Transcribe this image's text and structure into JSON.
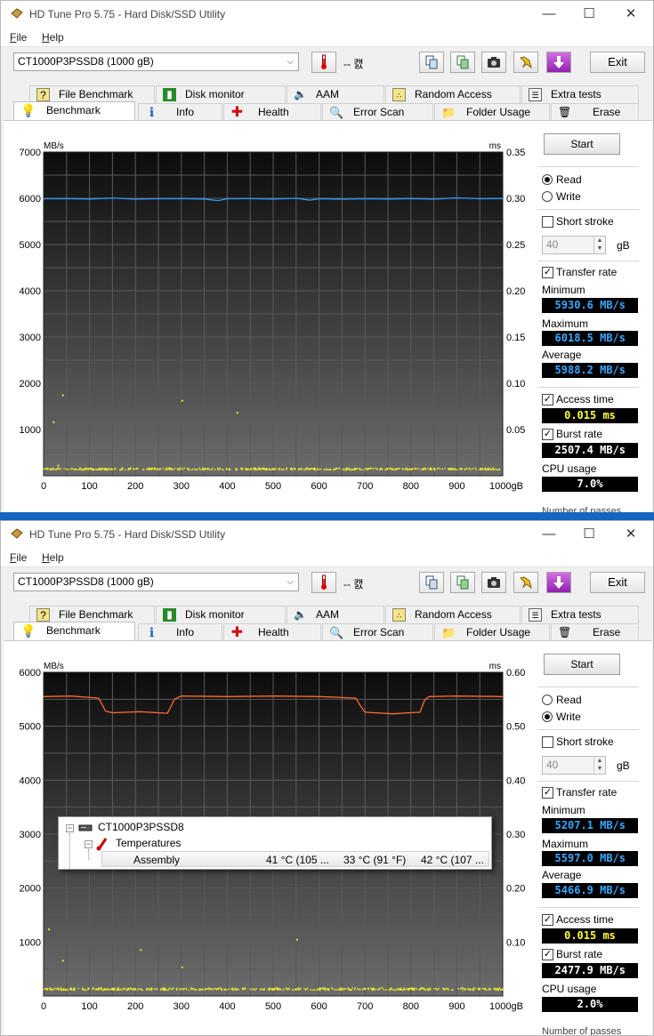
{
  "app": {
    "title": "HD Tune Pro 5.75 - Hard Disk/SSD Utility",
    "menu": {
      "file": "File",
      "file_key": "F",
      "file_rest": "ile",
      "help": "Help",
      "help_key": "H",
      "help_rest": "elp"
    },
    "window_controls": {
      "minimize": "—",
      "maximize": "☐",
      "close": "✕"
    }
  },
  "toolbar": {
    "drive": "CT1000P3PSSD8 (1000 gB)",
    "temperature": "-- 캜",
    "exit_label": "Exit",
    "icons": [
      "thermometer-icon",
      "copy-info-icon",
      "copy-screen-icon",
      "camera-icon",
      "options-icon",
      "download-icon"
    ]
  },
  "tabs": {
    "row1": [
      "File Benchmark",
      "Disk monitor",
      "AAM",
      "Random Access",
      "Extra tests"
    ],
    "row2": [
      "Benchmark",
      "Info",
      "Health",
      "Error Scan",
      "Folder Usage",
      "Erase"
    ],
    "active": "Benchmark"
  },
  "panels": [
    {
      "start_label": "Start",
      "read_label": "Read",
      "write_label": "Write",
      "mode": "read",
      "short_stroke_label": "Short stroke",
      "short_stroke_checked": false,
      "stroke_value": "40",
      "stroke_unit": "gB",
      "transfer_rate_label": "Transfer rate",
      "transfer_rate_checked": true,
      "minimum_label": "Minimum",
      "minimum": "5930.6 MB/s",
      "maximum_label": "Maximum",
      "maximum": "6018.5 MB/s",
      "average_label": "Average",
      "average": "5988.2 MB/s",
      "access_time_label": "Access time",
      "access_time_checked": true,
      "access_time": "0.015 ms",
      "burst_rate_label": "Burst rate",
      "burst_rate_checked": true,
      "burst_rate": "2507.4 MB/s",
      "cpu_usage_label": "CPU usage",
      "cpu_usage": "7.0%",
      "clipped_label": "Number of passes"
    },
    {
      "start_label": "Start",
      "read_label": "Read",
      "write_label": "Write",
      "mode": "write",
      "short_stroke_label": "Short stroke",
      "short_stroke_checked": false,
      "stroke_value": "40",
      "stroke_unit": "gB",
      "transfer_rate_label": "Transfer rate",
      "transfer_rate_checked": true,
      "minimum_label": "Minimum",
      "minimum": "5207.1 MB/s",
      "maximum_label": "Maximum",
      "maximum": "5597.0 MB/s",
      "average_label": "Average",
      "average": "5466.9 MB/s",
      "access_time_label": "Access time",
      "access_time_checked": true,
      "access_time": "0.015 ms",
      "burst_rate_label": "Burst rate",
      "burst_rate_checked": true,
      "burst_rate": "2477.9 MB/s",
      "cpu_usage_label": "CPU usage",
      "cpu_usage": "2.0%",
      "clipped_label": "Number of passes"
    }
  ],
  "chart_data": [
    {
      "type": "line",
      "ylabel": "MB/s",
      "y2label": "ms",
      "xlim": [
        0,
        1000
      ],
      "ylim": [
        0,
        7000
      ],
      "y2lim": [
        0,
        0.35
      ],
      "x_ticks": [
        "0",
        "100",
        "200",
        "300",
        "400",
        "500",
        "600",
        "700",
        "800",
        "900",
        "1000gB"
      ],
      "y_ticks": [
        "7000",
        "6000",
        "5000",
        "4000",
        "3000",
        "2000",
        "1000"
      ],
      "y2_ticks": [
        "0.35",
        "0.30",
        "0.25",
        "0.20",
        "0.15",
        "0.10",
        "0.05"
      ],
      "grid": true,
      "series": [
        {
          "color": "#3399ff",
          "x": [
            0,
            50,
            100,
            150,
            200,
            250,
            300,
            350,
            380,
            400,
            450,
            500,
            550,
            580,
            600,
            650,
            700,
            750,
            800,
            850,
            900,
            950,
            1000
          ],
          "y": [
            5990,
            5995,
            5985,
            6005,
            5980,
            5990,
            5995,
            5985,
            5950,
            5990,
            5992,
            5985,
            6000,
            5960,
            5990,
            5980,
            5990,
            5985,
            5995,
            5980,
            6010,
            5990,
            5995
          ]
        }
      ],
      "access_series": {
        "color": "#e8e830",
        "band_ms": [
          0.007,
          0.009
        ],
        "outliers": [
          {
            "x": 40,
            "ms": 0.088
          },
          {
            "x": 20,
            "ms": 0.059
          },
          {
            "x": 300,
            "ms": 0.082
          },
          {
            "x": 420,
            "ms": 0.069
          },
          {
            "x": 30,
            "ms": 0.012
          }
        ]
      }
    },
    {
      "type": "line",
      "ylabel": "MB/s",
      "y2label": "ms",
      "xlim": [
        0,
        1000
      ],
      "ylim": [
        0,
        6000
      ],
      "y2lim": [
        0,
        0.6
      ],
      "x_ticks": [
        "0",
        "100",
        "200",
        "300",
        "400",
        "500",
        "600",
        "700",
        "800",
        "900",
        "1000gB"
      ],
      "y_ticks": [
        "6000",
        "5000",
        "4000",
        "3000",
        "2000",
        "1000"
      ],
      "y2_ticks": [
        "0.60",
        "0.50",
        "0.40",
        "0.30",
        "0.20",
        "0.10"
      ],
      "grid": true,
      "series": [
        {
          "color": "#ff6a30",
          "x": [
            0,
            60,
            120,
            135,
            150,
            210,
            270,
            285,
            300,
            400,
            500,
            600,
            680,
            690,
            700,
            760,
            820,
            830,
            840,
            900,
            1000
          ],
          "y": [
            5550,
            5560,
            5520,
            5280,
            5250,
            5270,
            5240,
            5500,
            5560,
            5550,
            5560,
            5550,
            5520,
            5380,
            5260,
            5230,
            5260,
            5490,
            5550,
            5560,
            5550
          ]
        }
      ],
      "access_series": {
        "color": "#e8e830",
        "band_ms": [
          0.012,
          0.016
        ],
        "outliers": [
          {
            "x": 10,
            "ms": 0.125
          },
          {
            "x": 40,
            "ms": 0.067
          },
          {
            "x": 210,
            "ms": 0.087
          },
          {
            "x": 300,
            "ms": 0.055
          },
          {
            "x": 550,
            "ms": 0.106
          }
        ]
      }
    }
  ],
  "tooltip": {
    "root": "CT1000P3PSSD8",
    "group": "Temperatures",
    "sensor": "Assembly",
    "current": "41 °C  (105 ...",
    "min": "33 °C  (91 °F)",
    "max": "42 °C  (107 ..."
  }
}
